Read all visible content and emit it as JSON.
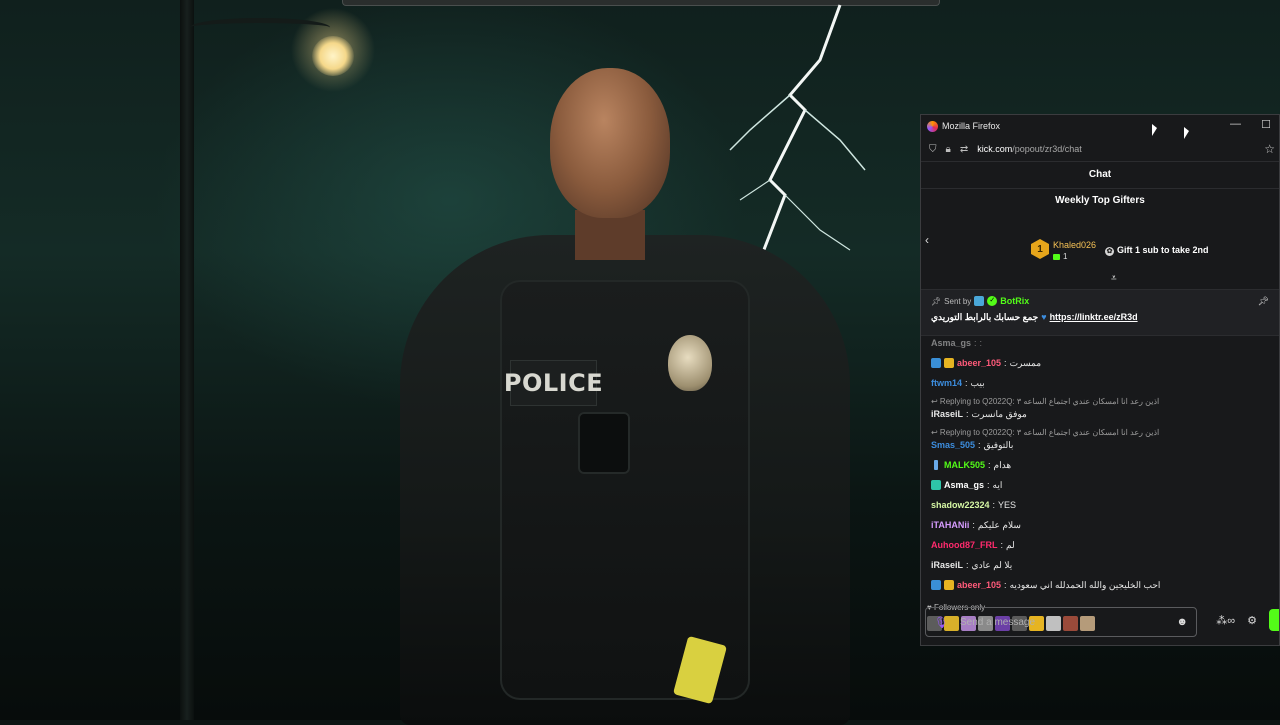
{
  "window": {
    "app_title": "Mozilla Firefox",
    "url_host": "kick.com",
    "url_path": "/popout/zr3d/chat",
    "min_icon": "—",
    "max_icon": "☐"
  },
  "chat": {
    "title": "Chat",
    "top_gifters": {
      "title": "Weekly Top Gifters",
      "rank": "1",
      "name": "Khaled026",
      "count": "1",
      "cta": "Gift 1 sub to take 2nd"
    },
    "pinned": {
      "sent_by_label": "Sent by",
      "author": "BotRix",
      "text": "جمع حسابك بالرابط التوريدي",
      "link": "https://linktr.ee/zR3d"
    },
    "messages": [
      {
        "user": "Asma_gs",
        "text": ":",
        "color": "#ffffff"
      },
      {
        "user": "abeer_105",
        "text": "ممسرت",
        "color": "#ff5a7a"
      },
      {
        "user": "ftwm14",
        "text": "بيب",
        "color": "#3c8dde"
      },
      {
        "user": "iRaseiL",
        "text": "موفق مانسرت",
        "color": "#e8e8e8",
        "reply": "Replying to Q2022Q: اذين رعد انا امسكان عندي اجتماع الساعه ٣"
      },
      {
        "user": "Smas_505",
        "text": "بالتوفيق",
        "color": "#3c8dde",
        "reply": "Replying to Q2022Q: اذين رعد انا امسكان عندي اجتماع الساعه ٣"
      },
      {
        "user": "MALK505",
        "text": "هدام",
        "color": "#53fc18"
      },
      {
        "user": "Asma_gs",
        "text": "ايه",
        "color": "#ffffff"
      },
      {
        "user": "shadow22324",
        "text": "YES",
        "color": "#d7f8a5"
      },
      {
        "user": "iTAHANii",
        "text": "سلام عليكم",
        "color": "#d69bff"
      },
      {
        "user": "Auhood87_FRL",
        "text": "لم",
        "color": "#ff2a6d"
      },
      {
        "user": "iRaseiL",
        "text": "يلا لم عادي",
        "color": "#e8e8e8"
      },
      {
        "user": "abeer_105",
        "text": "احب الخليجين والله الحمدلله اني سعوديه",
        "color": "#ff5a7a"
      }
    ],
    "followers_only": "Followers only",
    "emote_colors": [
      "#5c5c5c",
      "#d8b02a",
      "#a77ec4",
      "#8a8a8a",
      "#6b3fa6",
      "#5a5a5a",
      "#e6b422",
      "#c0c0c0",
      "#9a4a3a",
      "#b59b7a"
    ],
    "input_placeholder": "Send a message"
  },
  "colors": {
    "accent": "#53fc18",
    "gifter_gold": "#e6a51b"
  }
}
